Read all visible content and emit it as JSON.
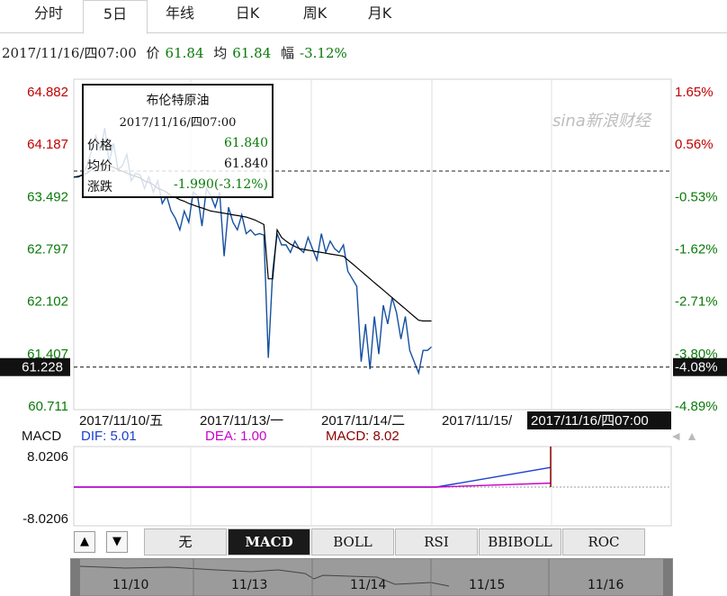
{
  "tabs": [
    {
      "label": "分时",
      "active": false
    },
    {
      "label": "5日",
      "active": true
    },
    {
      "label": "年线",
      "active": false
    },
    {
      "label": "日K",
      "active": false
    },
    {
      "label": "周K",
      "active": false
    },
    {
      "label": "月K",
      "active": false
    }
  ],
  "info": {
    "datetime": "2017/11/16/四07:00",
    "price_label": "价",
    "price": "61.84",
    "avg_label": "均",
    "avg": "61.84",
    "change_label": "幅",
    "change": "-3.12%"
  },
  "tooltip": {
    "name": "布伦特原油",
    "datetime": "2017/11/16/四07:00",
    "price_label": "价格",
    "price": "61.840",
    "avg_label": "均价",
    "avg": "61.840",
    "change_label": "涨跌",
    "change": "-1.990(-3.12%)"
  },
  "watermark": "sina新浪财经",
  "indicator_buttons": [
    {
      "label": "无",
      "active": false
    },
    {
      "label": "MACD",
      "active": true
    },
    {
      "label": "BOLL",
      "active": false
    },
    {
      "label": "RSI",
      "active": false
    },
    {
      "label": "BBIBOLL",
      "active": false
    },
    {
      "label": "ROC",
      "active": false
    }
  ],
  "nav_arrows": {
    "up": "▲",
    "down": "▼"
  },
  "navigator_labels": [
    "11/10",
    "11/13",
    "11/14",
    "11/15",
    "11/16"
  ],
  "colors": {
    "price_line": "#1450a0",
    "avg_line": "#000000",
    "up_text": "#c00000",
    "down_text": "#0a7a0a",
    "dif": "#1a3fcf",
    "dea": "#cc00cc",
    "macd": "#8b0000"
  },
  "chart_data": [
    {
      "type": "line",
      "title": "布伦特原油",
      "y_ticks_left": [
        "64.882",
        "64.187",
        "63.492",
        "62.797",
        "62.102",
        "61.407",
        "60.711"
      ],
      "y_ticks_right": [
        "1.65%",
        "0.56%",
        "-0.53%",
        "-1.62%",
        "-2.71%",
        "-3.80%",
        "-4.89%"
      ],
      "ylim": [
        60.711,
        64.882
      ],
      "reference_price": 63.83,
      "current_price_label": "61.228",
      "current_pct_label": "-4.08%",
      "current_price": 61.228,
      "x_labels": [
        "2017/11/10/五",
        "2017/11/13/一",
        "2017/11/14/二",
        "2017/11/15/",
        "2017/11/16/四07:00"
      ],
      "series": [
        {
          "values": [
            63.75,
            63.75,
            63.78,
            63.9,
            64.1,
            64.3,
            64.1,
            64.4,
            63.95,
            64.2,
            63.85,
            63.9,
            64.05,
            63.7,
            63.8,
            63.78,
            63.6,
            63.75,
            63.55,
            63.7,
            63.4,
            63.5,
            63.3,
            63.2,
            63.05,
            63.3,
            63.15,
            63.55,
            63.5,
            63.1,
            63.6,
            63.5,
            63.35,
            63.55,
            62.7,
            63.35,
            63.15,
            63.05,
            63.25,
            63.0,
            63.05,
            62.98,
            63.0,
            62.98,
            61.35,
            62.5,
            63.0,
            62.85,
            62.85,
            62.75,
            62.9,
            62.8,
            62.75,
            62.95,
            62.8,
            62.65,
            63.0,
            62.75,
            62.9,
            62.8,
            62.75,
            62.85,
            62.5,
            62.4,
            62.3,
            61.3,
            61.8,
            61.2,
            61.9,
            61.4,
            62.05,
            61.8,
            62.15,
            61.95,
            61.6,
            61.9,
            61.45,
            61.3,
            61.15,
            61.45,
            61.45,
            61.5
          ]
        },
        {
          "values": [
            63.75,
            63.76,
            63.78,
            63.8,
            63.85,
            63.88,
            63.9,
            63.92,
            63.9,
            63.88,
            63.85,
            63.83,
            63.8,
            63.78,
            63.76,
            63.74,
            63.7,
            63.68,
            63.65,
            63.6,
            63.58,
            63.55,
            63.5,
            63.48,
            63.45,
            63.43,
            63.4,
            63.38,
            63.36,
            63.34,
            63.32,
            63.3,
            63.29,
            63.28,
            63.27,
            63.26,
            63.25,
            63.24,
            63.23,
            63.22,
            63.2,
            63.18,
            63.15,
            63.12,
            62.4,
            62.4,
            63.05,
            62.95,
            62.9,
            62.86,
            62.83,
            62.8,
            62.79,
            62.78,
            62.77,
            62.76,
            62.75,
            62.74,
            62.73,
            62.72,
            62.71,
            62.7,
            62.65,
            62.6,
            62.55,
            62.5,
            62.45,
            62.4,
            62.35,
            62.3,
            62.25,
            62.2,
            62.15,
            62.1,
            62.05,
            62.0,
            61.95,
            61.9,
            61.85,
            61.84,
            61.84,
            61.84
          ]
        }
      ]
    },
    {
      "type": "line",
      "title": "MACD",
      "dif_label": "DIF: 5.01",
      "dea_label": "DEA: 1.00",
      "macd_label": "MACD: 8.02",
      "y_ticks": [
        "8.0206",
        "-8.0206"
      ],
      "ylim": [
        -8.0206,
        8.0206
      ],
      "series": [
        {
          "values": [
            0,
            0,
            0,
            0,
            0,
            0,
            0,
            0,
            0,
            0,
            5.01
          ]
        },
        {
          "values": [
            0,
            0,
            0,
            0,
            0,
            0,
            0,
            0,
            0,
            0.3,
            1.0
          ]
        }
      ]
    }
  ]
}
